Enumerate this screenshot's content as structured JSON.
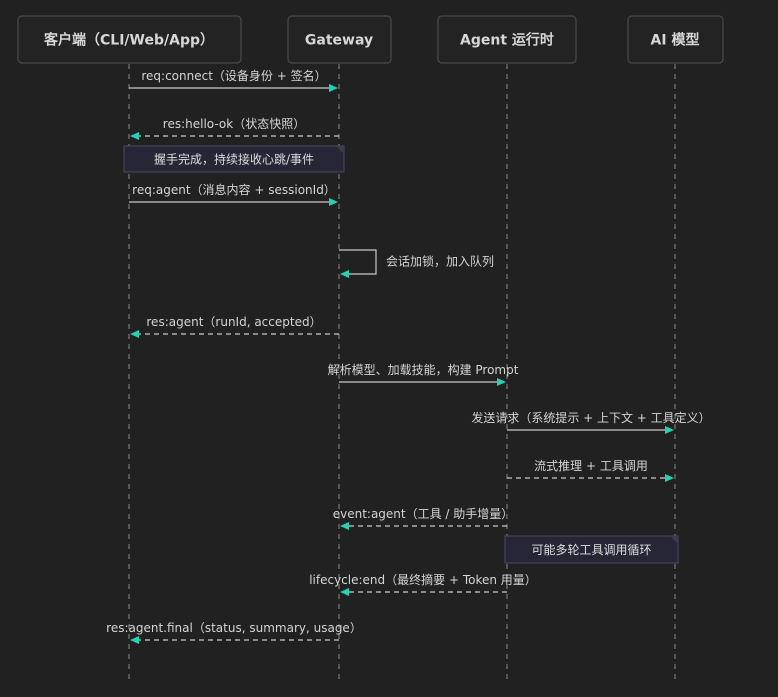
{
  "participants": [
    {
      "id": "client",
      "label": "客户端（CLI/Web/App）"
    },
    {
      "id": "gateway",
      "label": "Gateway"
    },
    {
      "id": "agent",
      "label": "Agent 运行时"
    },
    {
      "id": "model",
      "label": "AI 模型"
    }
  ],
  "messages": [
    {
      "from": "client",
      "to": "gateway",
      "label": "req:connect（设备身份 + 签名）",
      "dashed": false
    },
    {
      "from": "gateway",
      "to": "client",
      "label": "res:hello-ok（状态快照）",
      "dashed": true
    },
    {
      "type": "note",
      "label": "握手完成，持续接收心跳/事件"
    },
    {
      "from": "client",
      "to": "gateway",
      "label": "req:agent（消息内容 + sessionId）",
      "dashed": false
    },
    {
      "from": "gateway",
      "to": "gateway",
      "label": "会话加锁，加入队列",
      "dashed": false,
      "self": true
    },
    {
      "from": "gateway",
      "to": "client",
      "label": "res:agent（runId, accepted）",
      "dashed": true
    },
    {
      "from": "gateway",
      "to": "agent",
      "label": "解析模型、加载技能，构建 Prompt",
      "dashed": false
    },
    {
      "from": "agent",
      "to": "model",
      "label": "发送请求（系统提示 + 上下文 + 工具定义）",
      "dashed": false
    },
    {
      "from": "agent",
      "to": "model",
      "label": "流式推理 + 工具调用",
      "dashed": true
    },
    {
      "from": "agent",
      "to": "gateway",
      "label": "event:agent（工具 / 助手增量）",
      "dashed": true
    },
    {
      "type": "note",
      "label": "可能多轮工具调用循环"
    },
    {
      "from": "agent",
      "to": "gateway",
      "label": "lifecycle:end（最终摘要 + Token 用量）",
      "dashed": true
    },
    {
      "from": "gateway",
      "to": "client",
      "label": "res:agent.final（status, summary, usage）",
      "dashed": true
    }
  ]
}
